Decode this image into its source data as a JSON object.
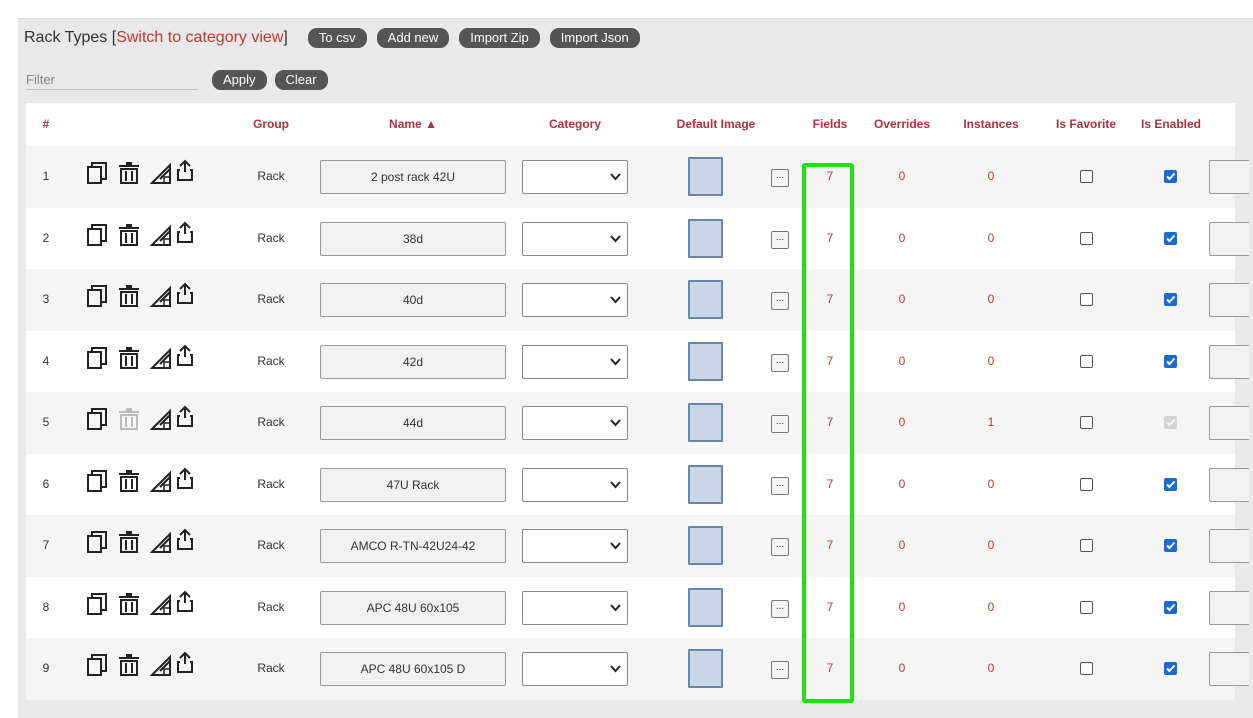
{
  "header": {
    "title": "Rack Types [",
    "switch_link": "Switch to category view",
    "title_end": "]",
    "buttons": {
      "to_csv": "To csv",
      "add_new": "Add new",
      "import_zip": "Import Zip",
      "import_json": "Import Json"
    }
  },
  "filter": {
    "placeholder": "Filter",
    "apply": "Apply",
    "clear": "Clear"
  },
  "columns": {
    "num": "#",
    "group": "Group",
    "name": "Name ▲",
    "category": "Category",
    "default_image": "Default Image",
    "fields": "Fields",
    "overrides": "Overrides",
    "instances": "Instances",
    "is_favorite": "Is Favorite",
    "is_enabled": "Is Enabled"
  },
  "rows": [
    {
      "num": "1",
      "group": "Rack",
      "name": "2 post rack 42U",
      "fields": "7",
      "overrides": "0",
      "instances": "0",
      "favorite": false,
      "enabled": true,
      "enabled_disabled": false,
      "delete_disabled": false
    },
    {
      "num": "2",
      "group": "Rack",
      "name": "38d",
      "fields": "7",
      "overrides": "0",
      "instances": "0",
      "favorite": false,
      "enabled": true,
      "enabled_disabled": false,
      "delete_disabled": false
    },
    {
      "num": "3",
      "group": "Rack",
      "name": "40d",
      "fields": "7",
      "overrides": "0",
      "instances": "0",
      "favorite": false,
      "enabled": true,
      "enabled_disabled": false,
      "delete_disabled": false
    },
    {
      "num": "4",
      "group": "Rack",
      "name": "42d",
      "fields": "7",
      "overrides": "0",
      "instances": "0",
      "favorite": false,
      "enabled": true,
      "enabled_disabled": false,
      "delete_disabled": false
    },
    {
      "num": "5",
      "group": "Rack",
      "name": "44d",
      "fields": "7",
      "overrides": "0",
      "instances": "1",
      "favorite": false,
      "enabled": true,
      "enabled_disabled": true,
      "delete_disabled": true
    },
    {
      "num": "6",
      "group": "Rack",
      "name": "47U Rack",
      "fields": "7",
      "overrides": "0",
      "instances": "0",
      "favorite": false,
      "enabled": true,
      "enabled_disabled": false,
      "delete_disabled": false
    },
    {
      "num": "7",
      "group": "Rack",
      "name": "AMCO R-TN-42U24-42",
      "fields": "7",
      "overrides": "0",
      "instances": "0",
      "favorite": false,
      "enabled": true,
      "enabled_disabled": false,
      "delete_disabled": false
    },
    {
      "num": "8",
      "group": "Rack",
      "name": "APC 48U 60x105",
      "fields": "7",
      "overrides": "0",
      "instances": "0",
      "favorite": false,
      "enabled": true,
      "enabled_disabled": false,
      "delete_disabled": false
    },
    {
      "num": "9",
      "group": "Rack",
      "name": "APC 48U 60x105 D",
      "fields": "7",
      "overrides": "0",
      "instances": "0",
      "favorite": false,
      "enabled": true,
      "enabled_disabled": false,
      "delete_disabled": false
    }
  ],
  "colors": {
    "accent_red": "#c0392b",
    "header_red": "#b03040",
    "highlight_green": "#22e010",
    "checkbox_blue": "#1a6ad4",
    "pill_bg": "#555555"
  },
  "icons": [
    "copy-icon",
    "trash-icon",
    "edit-icon",
    "export-icon",
    "chevron-down-icon",
    "checkmark-icon"
  ],
  "dots_label": "..."
}
